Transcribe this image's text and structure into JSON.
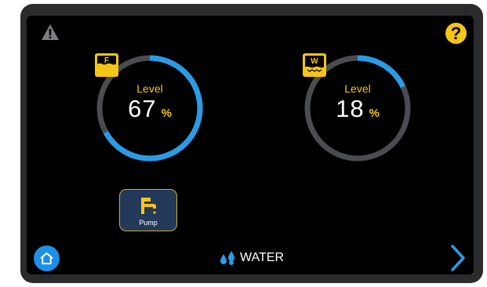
{
  "gauges": [
    {
      "label": "Level",
      "value": 67,
      "value_text": "67",
      "unit": "%",
      "tank_letter": "F",
      "tank_type": "fresh-water-tank-icon"
    },
    {
      "label": "Level",
      "value": 18,
      "value_text": "18",
      "unit": "%",
      "tank_letter": "W",
      "tank_type": "waste-water-tank-icon"
    }
  ],
  "pump": {
    "label": "Pump",
    "icon": "faucet-icon"
  },
  "footer": {
    "title": "WATER",
    "icon": "water-drops-icon"
  },
  "icons": {
    "warning": "warning-icon",
    "help": "help-icon",
    "home": "home-icon",
    "next": "chevron-right-icon"
  },
  "help_glyph": "?",
  "colors": {
    "accent": "#f5c518",
    "gauge_fill": "#2b9be6",
    "gauge_track": "#4a4c4f",
    "pump_bg": "#23395a",
    "home": "#1e8fe6",
    "background": "#000000"
  }
}
